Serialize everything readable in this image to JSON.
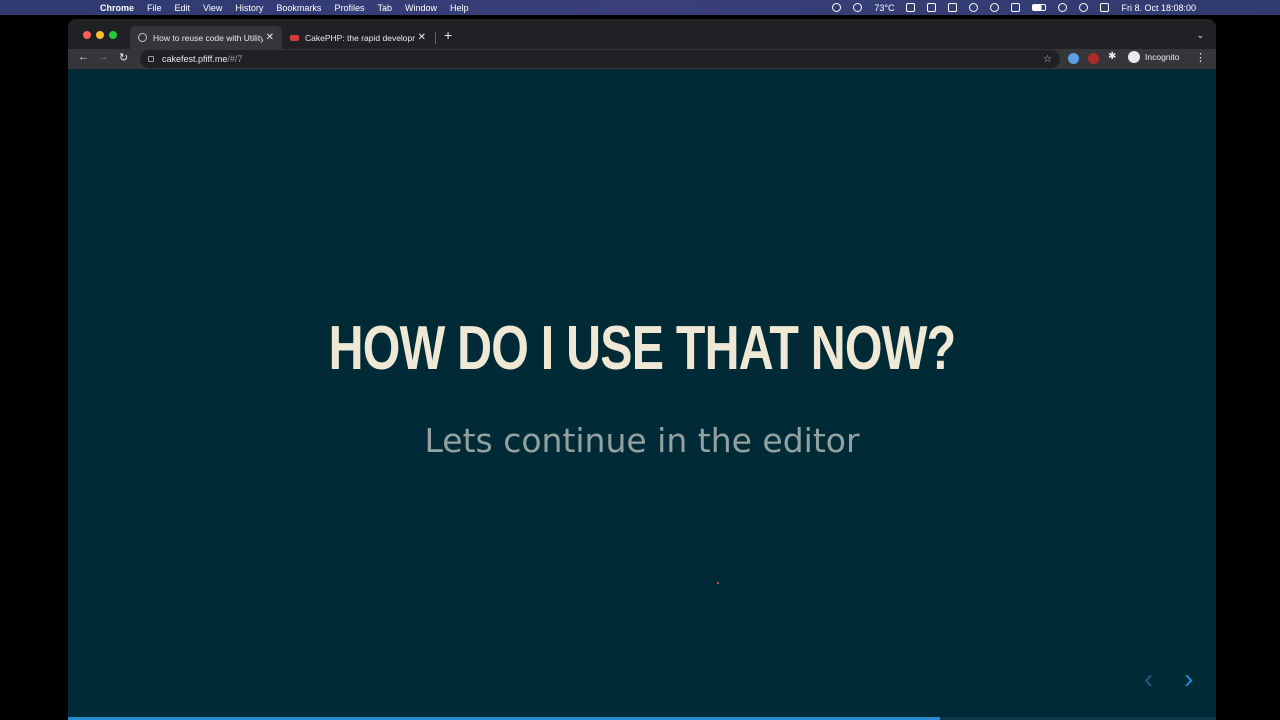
{
  "menubar": {
    "apple": "",
    "app": "Chrome",
    "items": [
      "File",
      "Edit",
      "View",
      "History",
      "Bookmarks",
      "Profiles",
      "Tab",
      "Window",
      "Help"
    ],
    "temperature": "73°C",
    "datetime": "Fri 8. Oct  18:08:00"
  },
  "browser": {
    "tabs": [
      {
        "title": "How to reuse code with Utility",
        "close": "✕"
      },
      {
        "title": "CakePHP: the rapid developme",
        "close": "✕"
      }
    ],
    "new_tab": "+",
    "url_host": "cakefest.pfiff.me",
    "url_path": "/#/7",
    "profile": "Incognito"
  },
  "slide": {
    "title": "HOW DO I USE THAT NOW?",
    "subtitle": "Lets continue in the editor",
    "progress": 0.76,
    "colors": {
      "background": "#002b36",
      "title": "#eee8d5",
      "subtitle": "#93a1a1",
      "accent": "#268bd2"
    }
  }
}
